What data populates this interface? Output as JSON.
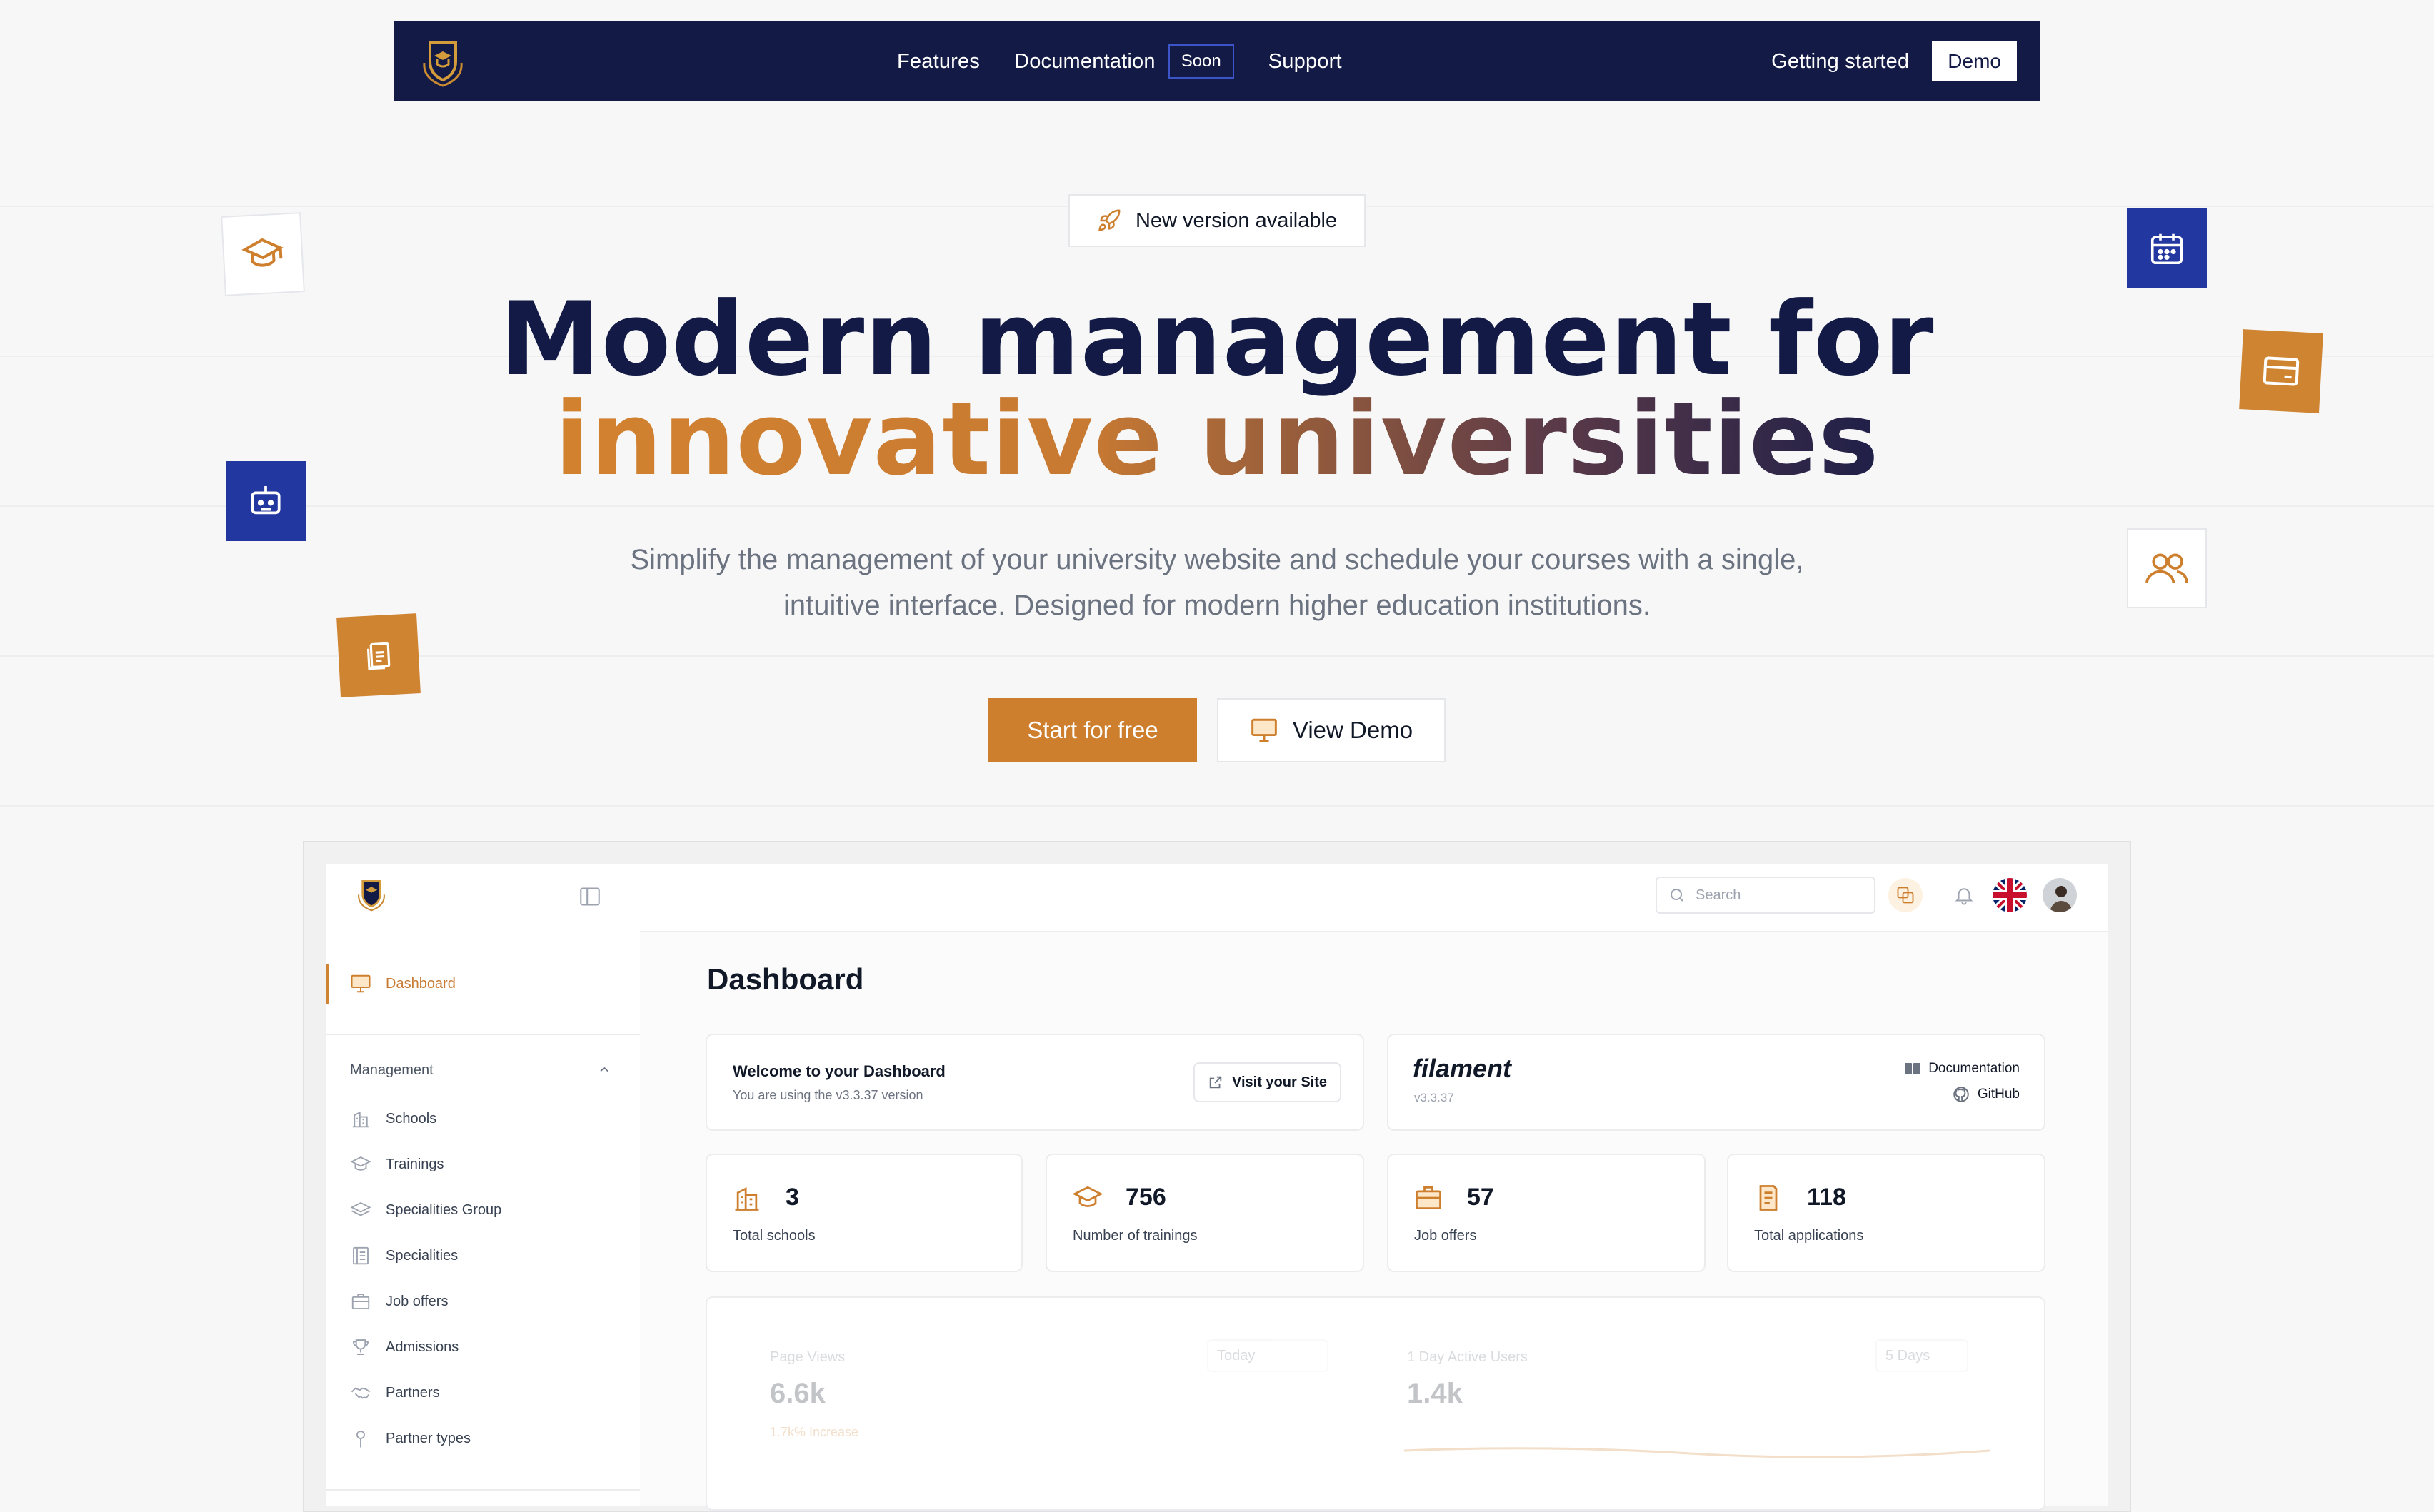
{
  "colors": {
    "navy": "#121a45",
    "orange": "#cd7f2e",
    "blue": "#2337a0"
  },
  "nav": {
    "links": [
      "Features",
      "Documentation",
      "Support"
    ],
    "soon_badge": "Soon",
    "getting_started": "Getting started",
    "demo": "Demo"
  },
  "hero": {
    "badge": "New version available",
    "title_line1": "Modern management for",
    "title_line2": "innovative universities",
    "subtitle_line1": "Simplify the management of your university website and schedule your courses with a single,",
    "subtitle_line2": "intuitive interface. Designed for modern higher education institutions.",
    "cta_start": "Start for free",
    "cta_demo": "View Demo"
  },
  "dashboard": {
    "sidebar": {
      "active_item": "Dashboard",
      "group_label": "Management",
      "items": [
        "Schools",
        "Trainings",
        "Specialities Group",
        "Specialities",
        "Job offers",
        "Admissions",
        "Partners",
        "Partner types"
      ]
    },
    "search_placeholder": "Search",
    "title": "Dashboard",
    "welcome": {
      "title": "Welcome to your Dashboard",
      "subtitle": "You are using the v3.3.37 version",
      "button": "Visit your Site"
    },
    "filament": {
      "name": "filament",
      "version": "v3.3.37",
      "docs": "Documentation",
      "github": "GitHub"
    },
    "stats": [
      {
        "value": "3",
        "label": "Total schools"
      },
      {
        "value": "756",
        "label": "Number of trainings"
      },
      {
        "value": "57",
        "label": "Job offers"
      },
      {
        "value": "118",
        "label": "Total applications"
      }
    ],
    "charts": {
      "left": {
        "label": "Page Views",
        "filter": "Today",
        "value": "6.6k",
        "trend": "1.7k% Increase"
      },
      "right": {
        "label": "1 Day Active Users",
        "filter": "5 Days",
        "value": "1.4k"
      }
    }
  }
}
